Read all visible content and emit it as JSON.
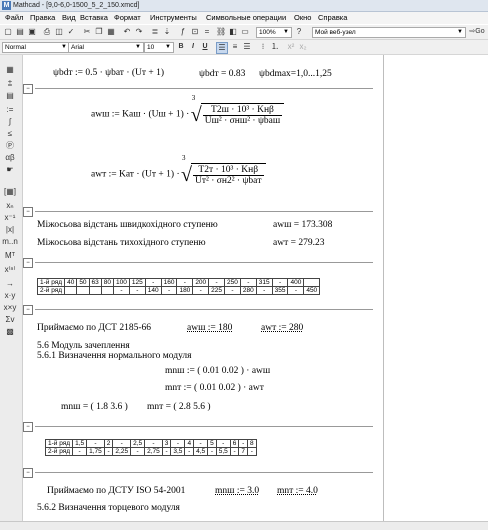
{
  "window": {
    "title": "Mathcad - [9,0-6,0-1500_5_2_150.xmcd]"
  },
  "menu": [
    "Файл",
    "Правка",
    "Вид",
    "Вставка",
    "Формат",
    "Инструменты",
    "Символьные операции",
    "Окно",
    "Справка"
  ],
  "toolbar": {
    "zoom": "100%",
    "resource": "Мой веб-узел",
    "go_label": "Go",
    "style": "Normal",
    "font": "Arial",
    "font_size": "10",
    "bold": "B",
    "italic": "I",
    "underline": "U"
  },
  "sheet": {
    "psi_line": {
      "def": "ψbdт := 0.5 · ψbат · (Uт + 1)",
      "result": "ψbdт = 0.83",
      "range": "ψbdmax=1,0...1,25"
    },
    "aw_fast": {
      "lhs": "awш := Kаш · (Uш + 1) ·",
      "root_index": "3",
      "numerator": "T2ш · 10³ · Kнβ",
      "denominator": "Uш² · σнш² · ψbaш"
    },
    "aw_slow": {
      "lhs": "awт := Kат · (Uт + 1) ·",
      "root_index": "3",
      "numerator": "T2т · 10³ · Kнβ",
      "denominator": "Uт² · σн2² · ψbaт"
    },
    "dist_fast": {
      "label": "Міжосьова відстань швидкохідного ступеню",
      "value": "awш = 173.308"
    },
    "dist_slow": {
      "label": "Міжосьова відстань тихохідного ступеню",
      "value": "awт = 279.23"
    },
    "table1": {
      "rows": [
        [
          "1-й ряд",
          "40",
          "50",
          "63",
          "80",
          "100",
          "125",
          "-",
          "160",
          "-",
          "200",
          "-",
          "250",
          "-",
          "315",
          "-",
          "400",
          ""
        ],
        [
          "2-й ряд",
          "",
          "",
          "",
          "",
          "-",
          "-",
          "140",
          "-",
          "180",
          "-",
          "225",
          "-",
          "280",
          "-",
          "355",
          "-",
          "450"
        ]
      ]
    },
    "accept_dst": {
      "label": "Приймаємо по ДСТ 2185-66",
      "v1": "awш := 180",
      "v2": "awт := 280"
    },
    "module_heading1": "5.6 Модуль зачеплення",
    "module_heading2": "5.6.1 Визначення нормального модуля",
    "mn_fast": "mnш := ( 0.01  0.02 ) · awш",
    "mn_slow": "mnт := ( 0.01  0.02 ) · awт",
    "mn_range_fast": "mnш = ( 1.8  3.6 )",
    "mn_range_slow": "mnт = ( 2.8  5.6 )",
    "table2": {
      "rows": [
        [
          "1-й ряд",
          "1,5",
          "-",
          "2",
          "-",
          "2,5",
          "-",
          "3",
          "-",
          "4",
          "-",
          "5",
          "-",
          "6",
          "-",
          "8"
        ],
        [
          "2-й ряд",
          "-",
          "1,75",
          "-",
          "2,25",
          "-",
          "2,75",
          "-",
          "3,5",
          "-",
          "4,5",
          "-",
          "5,5",
          "-",
          "7",
          "-"
        ]
      ]
    },
    "accept_iso": {
      "label": "Приймаємо по ДСТУ ISO 54-2001",
      "v1": "mnш := 3.0",
      "v2": "mnт := 4.0"
    },
    "module_heading3": "5.6.2 Визначення торцевого модуля"
  }
}
